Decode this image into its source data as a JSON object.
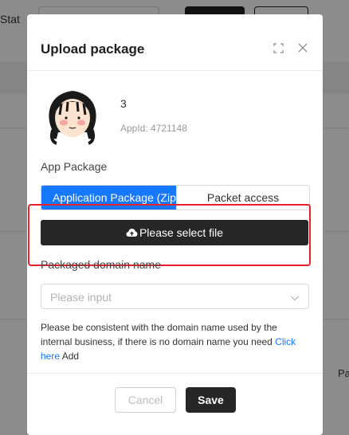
{
  "background": {
    "status_label": "Stat",
    "right_edge_text": "Pa"
  },
  "modal": {
    "title": "Upload package",
    "expand_icon": "expand-icon",
    "close_icon": "close-icon"
  },
  "app": {
    "name": "3",
    "id_label": "AppId:",
    "id_value": "4721148",
    "avatar_icon": "cartoon-girl-avatar"
  },
  "package": {
    "label": "App Package",
    "tabs": [
      {
        "label": "Application Package (Zip)",
        "active": true
      },
      {
        "label": "Packet access",
        "active": false
      }
    ],
    "select_file_label": "Please select file",
    "select_file_icon": "cloud-upload-icon"
  },
  "domain": {
    "label": "Packaged domain name",
    "placeholder": "Please input",
    "help_before": "Please be consistent with the domain name used by the internal business, if there is no domain name you need",
    "help_link": "Click here",
    "help_after": "Add"
  },
  "footer": {
    "cancel_label": "Cancel",
    "save_label": "Save"
  },
  "colors": {
    "accent": "#1677ff",
    "primary_dark": "#262626",
    "highlight": "#e8222a"
  }
}
